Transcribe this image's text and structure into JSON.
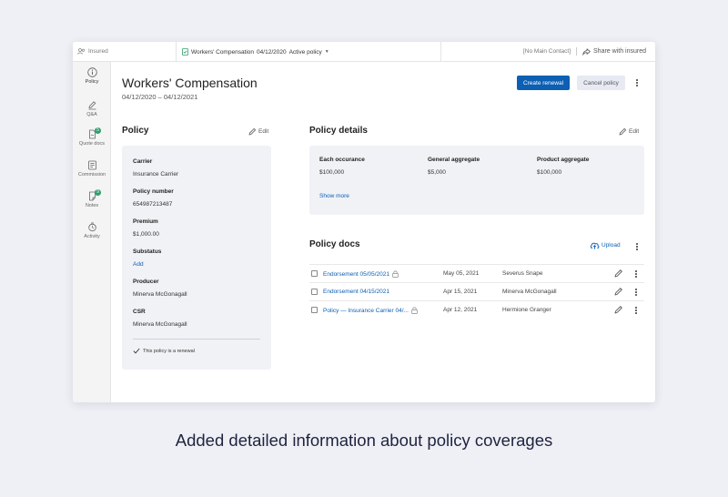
{
  "topbar": {
    "insured_label": "Insured",
    "tab_label": "Workers' Compensation",
    "tab_date": "04/12/2020",
    "tab_status": "Active policy",
    "main_contact": "[No Main Contact]",
    "share_label": "Share with insured"
  },
  "sidebar": {
    "items": [
      {
        "label": "Policy",
        "icon": "info-icon"
      },
      {
        "label": "Q&A",
        "icon": "pen-chat-icon"
      },
      {
        "label": "Quote docs",
        "icon": "document-icon",
        "badge": "5"
      },
      {
        "label": "Commission",
        "icon": "commission-icon"
      },
      {
        "label": "Notes",
        "icon": "note-icon",
        "badge": "9"
      },
      {
        "label": "Activity",
        "icon": "activity-icon"
      }
    ]
  },
  "header": {
    "title": "Workers' Compensation",
    "date_range": "04/12/2020 – 04/12/2021",
    "create_renewal": "Create renewal",
    "cancel_policy": "Cancel policy"
  },
  "policy": {
    "title": "Policy",
    "edit_label": "Edit",
    "fields": [
      {
        "label": "Carrier",
        "value": "Insurance Carrier"
      },
      {
        "label": "Policy number",
        "value": "654987213487"
      },
      {
        "label": "Premium",
        "value": "$1,000.00"
      },
      {
        "label": "Substatus",
        "value": "Add"
      },
      {
        "label": "Producer",
        "value": "Minerva McGonagall"
      },
      {
        "label": "CSR",
        "value": "Minerva McGonagall"
      }
    ],
    "renewal_note": "This policy is a renewal"
  },
  "policy_details": {
    "title": "Policy details",
    "edit_label": "Edit",
    "columns": [
      {
        "label": "Each occurance",
        "value": "$100,000"
      },
      {
        "label": "General aggregate",
        "value": "$5,000"
      },
      {
        "label": "Product aggregate",
        "value": "$100,000"
      }
    ],
    "show_more": "Show more"
  },
  "policy_docs": {
    "title": "Policy docs",
    "upload_label": "Upload",
    "rows": [
      {
        "name": "Endorsement 05/05/2021",
        "date": "May 05, 2021",
        "person": "Severus Snape"
      },
      {
        "name": "Endorsement 04/15/2021",
        "date": "Apr 15, 2021",
        "person": "Minerva McGonagall"
      },
      {
        "name": "Policy — Insurance Carrier 04/...",
        "date": "Apr 12, 2021",
        "person": "Hermione Granger"
      }
    ]
  },
  "caption": "Added detailed information about policy coverages",
  "colors": {
    "accent": "#0c5fb3",
    "badge": "#2f9e6c",
    "card_bg": "#f1f2f6",
    "page_bg": "#eef0f5"
  }
}
